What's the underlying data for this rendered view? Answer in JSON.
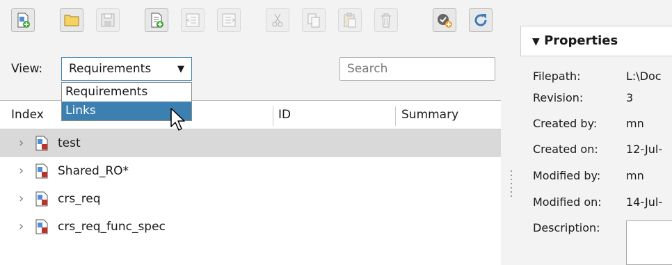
{
  "toolbar": {
    "buttons": [
      {
        "name": "new-requirement-set-icon",
        "enabled": true
      },
      {
        "name": "open-folder-icon",
        "enabled": true
      },
      {
        "name": "save-icon",
        "enabled": false
      },
      {
        "name": "add-requirement-icon",
        "enabled": true
      },
      {
        "name": "demote-icon",
        "enabled": false
      },
      {
        "name": "promote-icon",
        "enabled": false
      },
      {
        "name": "cut-icon",
        "enabled": false
      },
      {
        "name": "copy-icon",
        "enabled": false
      },
      {
        "name": "paste-icon",
        "enabled": false
      },
      {
        "name": "delete-icon",
        "enabled": false
      },
      {
        "name": "verify-add-icon",
        "enabled": true
      },
      {
        "name": "refresh-icon",
        "enabled": true
      }
    ]
  },
  "view": {
    "label": "View:",
    "selected": "Requirements",
    "options": [
      "Requirements",
      "Links"
    ],
    "highlighted": "Links"
  },
  "search": {
    "placeholder": "Search"
  },
  "table": {
    "columns": [
      "Index",
      "ID",
      "Summary"
    ],
    "rows": [
      {
        "label": "test",
        "selected": true
      },
      {
        "label": "Shared_RO*",
        "selected": false
      },
      {
        "label": "crs_req",
        "selected": false
      },
      {
        "label": "crs_req_func_spec",
        "selected": false
      }
    ]
  },
  "properties": {
    "title": "Properties",
    "fields": [
      {
        "label": "Filepath:",
        "value": "L:\\Doc"
      },
      {
        "label": "Revision:",
        "value": "3"
      },
      {
        "label": "Created by:",
        "value": "mn"
      },
      {
        "label": "Created on:",
        "value": "12-Jul-"
      },
      {
        "label": "Modified by:",
        "value": "mn"
      },
      {
        "label": "Modified on:",
        "value": "14-Jul-"
      },
      {
        "label": "Description:",
        "value": ""
      }
    ]
  },
  "colors": {
    "accent": "#3c7fb1",
    "selected_row": "#d9d9d9"
  }
}
